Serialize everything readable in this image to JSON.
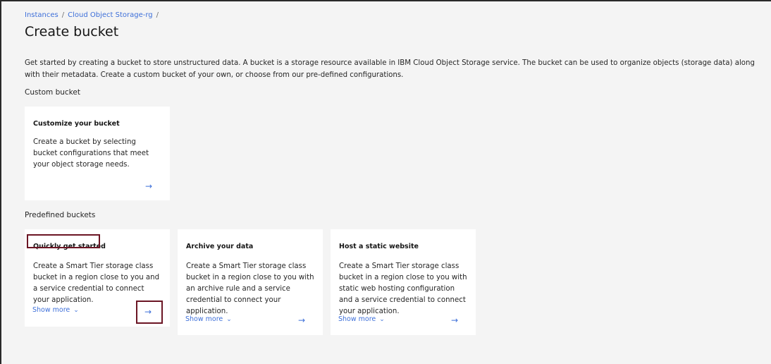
{
  "breadcrumb": {
    "items": [
      "Instances",
      "Cloud Object Storage-rg"
    ],
    "separator": "/"
  },
  "page": {
    "title": "Create bucket",
    "intro": "Get started by creating a bucket to store unstructured data. A bucket is a storage resource available in IBM Cloud Object Storage service. The bucket can be used to organize objects (storage data) along with their metadata. Create a custom bucket of your own, or choose from our pre-defined configurations."
  },
  "custom": {
    "section_label": "Custom bucket",
    "card": {
      "title": "Customize your bucket",
      "description": "Create a bucket by selecting bucket configurations that meet your object storage needs.",
      "arrow": "→"
    }
  },
  "predefined": {
    "section_label": "Predefined buckets",
    "cards": [
      {
        "title": "Quickly get started",
        "description": "Create a Smart Tier storage class bucket in a region close to you and a service credential to connect your application.",
        "show_more": "Show more",
        "arrow": "→"
      },
      {
        "title": "Archive your data",
        "description": "Create a Smart Tier storage class bucket in a region close to you with an archive rule and a service credential to connect your application.",
        "show_more": "Show more",
        "arrow": "→"
      },
      {
        "title": "Host a static website",
        "description": "Create a Smart Tier storage class bucket in a region close to you with static web hosting configuration and a service credential to connect your application.",
        "show_more": "Show more",
        "arrow": "→"
      }
    ]
  },
  "colors": {
    "link": "#3d6fd9",
    "highlight": "#6b1524",
    "background": "#f4f4f4",
    "card": "#ffffff"
  },
  "icons": {
    "chevron": "chevron-down-icon",
    "arrow": "arrow-right-icon"
  }
}
